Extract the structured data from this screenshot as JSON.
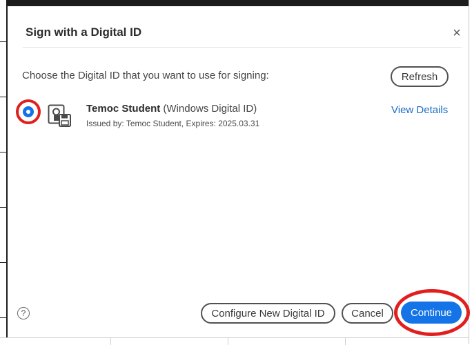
{
  "dialog": {
    "title": "Sign with a Digital ID",
    "close_symbol": "×",
    "prompt": "Choose the Digital ID that you want to use for signing:",
    "refresh_label": "Refresh"
  },
  "digital_ids": [
    {
      "name": "Temoc Student",
      "type": "(Windows Digital ID)",
      "details": "Issued by: Temoc Student, Expires: 2025.03.31",
      "view_details_label": "View Details",
      "selected": true,
      "icon": "digital-id-certificate-icon"
    }
  ],
  "footer": {
    "help_symbol": "?",
    "configure_label": "Configure New Digital ID",
    "cancel_label": "Cancel",
    "continue_label": "Continue"
  },
  "colors": {
    "accent": "#1473e6",
    "annotation": "#e0201f",
    "link": "#1a6cc4"
  }
}
